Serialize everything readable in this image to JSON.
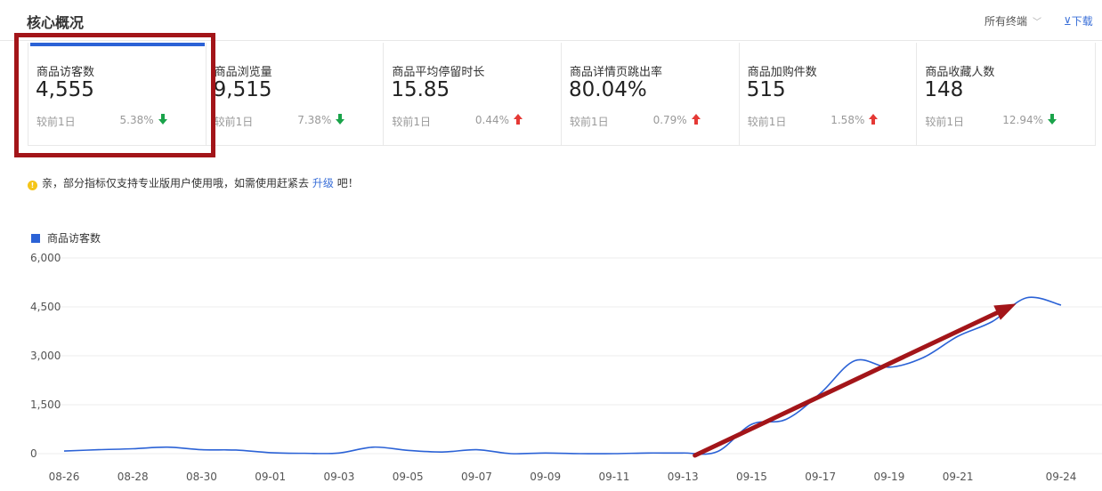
{
  "header": {
    "title": "核心概况",
    "terminal_label": "所有终端",
    "terminal_chevron": "﹀",
    "download_label": "⊻下载"
  },
  "metrics": [
    {
      "label": "商品访客数",
      "value": "4,555",
      "compare_label": "较前1日",
      "change": "5.38%",
      "direction": "down"
    },
    {
      "label": "商品浏览量",
      "value": "9,515",
      "compare_label": "较前1日",
      "change": "7.38%",
      "direction": "down"
    },
    {
      "label": "商品平均停留时长",
      "value": "15.85",
      "compare_label": "较前1日",
      "change": "0.44%",
      "direction": "up"
    },
    {
      "label": "商品详情页跳出率",
      "value": "80.04%",
      "compare_label": "较前1日",
      "change": "0.79%",
      "direction": "up"
    },
    {
      "label": "商品加购件数",
      "value": "515",
      "compare_label": "较前1日",
      "change": "1.58%",
      "direction": "up"
    },
    {
      "label": "商品收藏人数",
      "value": "148",
      "compare_label": "较前1日",
      "change": "12.94%",
      "direction": "down"
    }
  ],
  "notice": {
    "icon": "info-icon",
    "text_before": "亲，部分指标仅支持专业版用户使用哦，如需使用赶紧去",
    "link": "升级",
    "text_after": "吧！"
  },
  "colors": {
    "accent": "#2b62d6",
    "down": "#1aa34a",
    "up": "#e53935",
    "annotation": "#a31519"
  },
  "chart_data": {
    "type": "line",
    "series": [
      {
        "name": "商品访客数",
        "x": [
          "08-26",
          "08-27",
          "08-28",
          "08-29",
          "08-30",
          "08-31",
          "09-01",
          "09-02",
          "09-03",
          "09-04",
          "09-05",
          "09-06",
          "09-07",
          "09-08",
          "09-09",
          "09-10",
          "09-11",
          "09-12",
          "09-13",
          "09-14",
          "09-15",
          "09-16",
          "09-17",
          "09-18",
          "09-19",
          "09-20",
          "09-21",
          "09-22",
          "09-23",
          "09-24"
        ],
        "values": [
          80,
          120,
          150,
          200,
          120,
          110,
          30,
          10,
          20,
          200,
          100,
          50,
          120,
          0,
          20,
          0,
          0,
          20,
          20,
          60,
          900,
          1050,
          1850,
          2850,
          2650,
          2950,
          3600,
          4050,
          4780,
          4555
        ]
      }
    ],
    "x_tick_labels": [
      "08-26",
      "08-28",
      "08-30",
      "09-01",
      "09-03",
      "09-05",
      "09-07",
      "09-09",
      "09-11",
      "09-13",
      "09-15",
      "09-17",
      "09-19",
      "09-21",
      "09-24"
    ],
    "y_tick_labels": [
      "0",
      "1,500",
      "3,000",
      "4,500",
      "6,000"
    ],
    "ylim": [
      0,
      6000
    ],
    "grid": true,
    "legend": "top-left",
    "annotation": "red arrow showing upward trend from 09-13 to 09-23"
  }
}
